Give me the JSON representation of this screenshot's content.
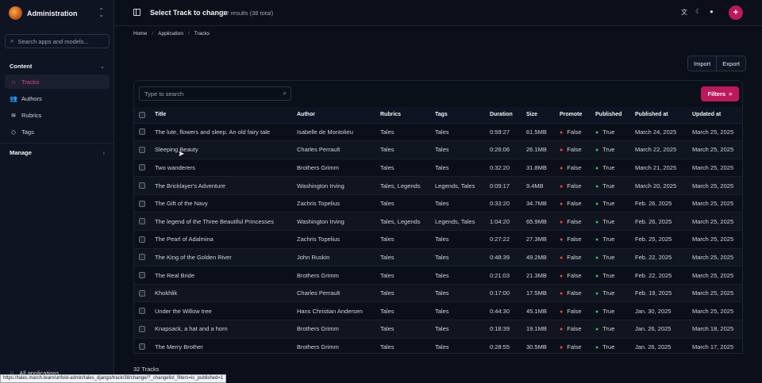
{
  "sidebar": {
    "brand": "Administration",
    "search_placeholder": "Search apps and models...",
    "section_content": "Content",
    "items": [
      {
        "label": "Tracks",
        "icon": "headphones-icon",
        "active": true
      },
      {
        "label": "Authors",
        "icon": "users-icon"
      },
      {
        "label": "Rubrics",
        "icon": "layers-icon"
      },
      {
        "label": "Tags",
        "icon": "tag-icon"
      }
    ],
    "section_manage": "Manage",
    "all_apps": "All applications"
  },
  "header": {
    "title": "Select Track to change",
    "results": "32 results (38 total)"
  },
  "breadcrumbs": [
    "Home",
    "Application",
    "Tracks"
  ],
  "actions": {
    "import": "Import",
    "export": "Export"
  },
  "table": {
    "search_placeholder": "Type to search",
    "filters_label": "Filters",
    "columns": [
      "Title",
      "Author",
      "Rubrics",
      "Tags",
      "Duration",
      "Size",
      "Promote",
      "Published",
      "Published at",
      "Updated at"
    ],
    "rows": [
      {
        "title": "The lute, flowers and sleep. An old fairy tale",
        "author": "Isabelle de Montolieu",
        "rubrics": "Tales",
        "tags": "Tales",
        "duration": "0:59:27",
        "size": "61.5MB",
        "promote": "False",
        "published": "True",
        "published_at": "March 24, 2025",
        "updated_at": "March 25, 2025"
      },
      {
        "title": "Sleeping Beauty",
        "author": "Charles Perrault",
        "rubrics": "Tales",
        "tags": "Tales",
        "duration": "0:26:06",
        "size": "26.1MB",
        "promote": "False",
        "published": "True",
        "published_at": "March 22, 2025",
        "updated_at": "March 25, 2025"
      },
      {
        "title": "Two wanderers",
        "author": "Brothers Grimm",
        "rubrics": "Tales",
        "tags": "Tales",
        "duration": "0:32:20",
        "size": "31.8MB",
        "promote": "False",
        "published": "True",
        "published_at": "March 21, 2025",
        "updated_at": "March 25, 2025"
      },
      {
        "title": "The Bricklayer's Adventure",
        "author": "Washington Irving",
        "rubrics": "Tales, Legends",
        "tags": "Legends, Tales",
        "duration": "0:09:17",
        "size": "9.4MB",
        "promote": "False",
        "published": "True",
        "published_at": "March 20, 2025",
        "updated_at": "March 25, 2025"
      },
      {
        "title": "The Gift of the Navy",
        "author": "Zachris Topelius",
        "rubrics": "Tales",
        "tags": "Tales",
        "duration": "0:33:20",
        "size": "34.7MB",
        "promote": "False",
        "published": "True",
        "published_at": "Feb. 26, 2025",
        "updated_at": "March 25, 2025"
      },
      {
        "title": "The legend of the Three Beautiful Princesses",
        "author": "Washington Irving",
        "rubrics": "Tales, Legends",
        "tags": "Legends, Tales",
        "duration": "1:04:20",
        "size": "65.9MB",
        "promote": "False",
        "published": "True",
        "published_at": "Feb. 26, 2025",
        "updated_at": "March 25, 2025"
      },
      {
        "title": "The Pearl of Adalmina",
        "author": "Zachris Topelius",
        "rubrics": "Tales",
        "tags": "Tales",
        "duration": "0:27:22",
        "size": "27.3MB",
        "promote": "False",
        "published": "True",
        "published_at": "Feb. 25, 2025",
        "updated_at": "March 25, 2025"
      },
      {
        "title": "The King of the Golden River",
        "author": "John Ruskin",
        "rubrics": "Tales",
        "tags": "Tales",
        "duration": "0:48:39",
        "size": "49.2MB",
        "promote": "False",
        "published": "True",
        "published_at": "Feb. 22, 2025",
        "updated_at": "March 25, 2025"
      },
      {
        "title": "The Real Bride",
        "author": "Brothers Grimm",
        "rubrics": "Tales",
        "tags": "Tales",
        "duration": "0:21:03",
        "size": "21.3MB",
        "promote": "False",
        "published": "True",
        "published_at": "Feb. 22, 2025",
        "updated_at": "March 25, 2025"
      },
      {
        "title": "Khokhlik",
        "author": "Charles Perrault",
        "rubrics": "Tales",
        "tags": "Tales",
        "duration": "0:17:00",
        "size": "17.5MB",
        "promote": "False",
        "published": "True",
        "published_at": "Feb. 19, 2025",
        "updated_at": "March 25, 2025"
      },
      {
        "title": "Under the Willow tree",
        "author": "Hans Christian Andersen",
        "rubrics": "Tales",
        "tags": "Tales",
        "duration": "0:44:30",
        "size": "45.1MB",
        "promote": "False",
        "published": "True",
        "published_at": "Jan. 30, 2025",
        "updated_at": "March 25, 2025"
      },
      {
        "title": "Knapsack, a hat and a horn",
        "author": "Brothers Grimm",
        "rubrics": "Tales",
        "tags": "Tales",
        "duration": "0:18:39",
        "size": "19.1MB",
        "promote": "False",
        "published": "True",
        "published_at": "Jan. 26, 2025",
        "updated_at": "March 18, 2025"
      },
      {
        "title": "The Merry Brother",
        "author": "Brothers Grimm",
        "rubrics": "Tales",
        "tags": "Tales",
        "duration": "0:28:55",
        "size": "30.5MB",
        "promote": "False",
        "published": "True",
        "published_at": "Jan. 26, 2025",
        "updated_at": "March 17, 2025"
      }
    ]
  },
  "footer_count": "32 Tracks",
  "status_url": "https://tales.march.team/unfold-admin/tales_django/track/38/change/?_changelist_filters=is_published=1",
  "colors": {
    "accent": "#be185d",
    "active_nav": "#e0457b",
    "false_dot": "#ef4444",
    "true_dot": "#22c55e",
    "background": "#0b0f1a"
  }
}
